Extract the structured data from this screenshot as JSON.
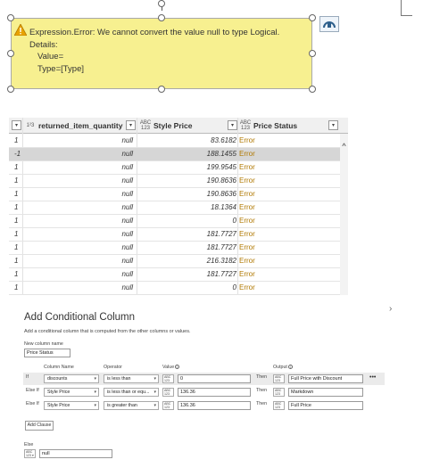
{
  "error": {
    "message": "Expression.Error: We cannot convert the value null to type Logical.",
    "details_label": "Details:",
    "value_label": "Value=",
    "type_label": "Type=[Type]"
  },
  "grid": {
    "columns": [
      {
        "type": "1²3",
        "name": "returned_item_quantity"
      },
      {
        "type": "ABC 123",
        "name": "Style Price"
      },
      {
        "type": "ABC 123",
        "name": "Price Status"
      }
    ],
    "rows": [
      {
        "c1": "1",
        "c2": "null",
        "c3": "83.6182",
        "c4": "Error"
      },
      {
        "c1": "-1",
        "c2": "null",
        "c3": "188.1455",
        "c4": "Error"
      },
      {
        "c1": "1",
        "c2": "null",
        "c3": "199.9545",
        "c4": "Error"
      },
      {
        "c1": "1",
        "c2": "null",
        "c3": "190.8636",
        "c4": "Error"
      },
      {
        "c1": "1",
        "c2": "null",
        "c3": "190.8636",
        "c4": "Error"
      },
      {
        "c1": "1",
        "c2": "null",
        "c3": "18.1364",
        "c4": "Error"
      },
      {
        "c1": "1",
        "c2": "null",
        "c3": "0",
        "c4": "Error"
      },
      {
        "c1": "1",
        "c2": "null",
        "c3": "181.7727",
        "c4": "Error"
      },
      {
        "c1": "1",
        "c2": "null",
        "c3": "181.7727",
        "c4": "Error"
      },
      {
        "c1": "1",
        "c2": "null",
        "c3": "216.3182",
        "c4": "Error"
      },
      {
        "c1": "1",
        "c2": "null",
        "c3": "181.7727",
        "c4": "Error"
      },
      {
        "c1": "1",
        "c2": "null",
        "c3": "0",
        "c4": "Error"
      }
    ],
    "selected_row": 1
  },
  "dialog": {
    "title": "Add Conditional Column",
    "description": "Add a conditional column that is computed from the other columns or values.",
    "new_column_label": "New column name",
    "new_column_value": "Price Status",
    "headers": {
      "column": "Column Name",
      "operator": "Operator",
      "value": "Value",
      "output": "Output"
    },
    "clauses": [
      {
        "kind": "If",
        "column": "discounts",
        "operator": "is less than",
        "value": "0",
        "then": "Then",
        "output": "Full Price with Discount"
      },
      {
        "kind": "Else If",
        "column": "Style Price",
        "operator": "is less than or equ...",
        "value": "136.36",
        "then": "Then",
        "output": "Markdown"
      },
      {
        "kind": "Else If",
        "column": "Style Price",
        "operator": "is greater than",
        "value": "136.36",
        "then": "Then",
        "output": "Full Price"
      }
    ],
    "add_clause": "Add Clause",
    "else_label": "Else",
    "else_value": "null",
    "more": "•••",
    "type_glyph": "ABC 123"
  }
}
